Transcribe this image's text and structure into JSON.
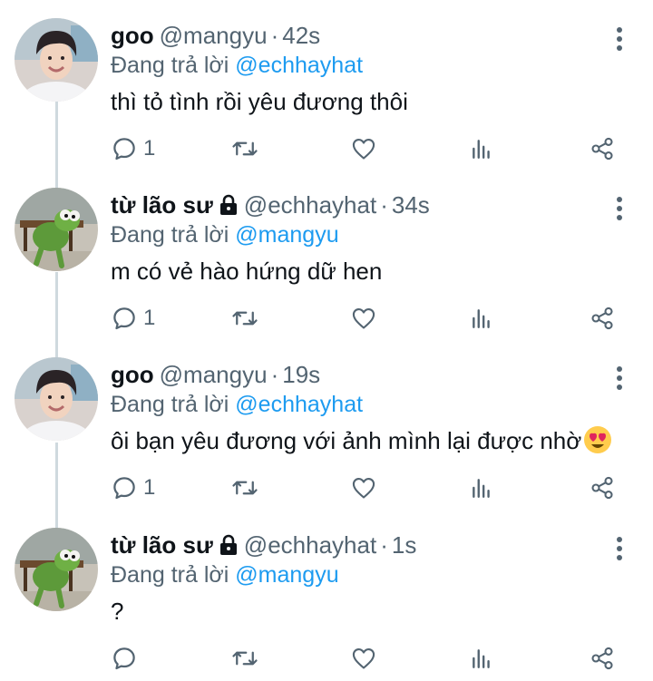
{
  "thread": {
    "tweets": [
      {
        "name": "goo",
        "handle": "@mangyu",
        "separator": "·",
        "time": "42s",
        "locked": false,
        "avatar_icon": "profile-photo-boy",
        "reply_prefix": "Đang trả lời",
        "reply_to": "@echhayhat",
        "text": "thì tỏ tình rồi yêu đương thôi",
        "emoji": "",
        "reply_count": "1"
      },
      {
        "name": "từ lão sư",
        "handle": "@echhayhat",
        "separator": "·",
        "time": "34s",
        "locked": true,
        "avatar_icon": "profile-photo-kermit",
        "reply_prefix": "Đang trả lời",
        "reply_to": "@mangyu",
        "text": "m có vẻ hào hứng dữ hen",
        "emoji": "",
        "reply_count": "1"
      },
      {
        "name": "goo",
        "handle": "@mangyu",
        "separator": "·",
        "time": "19s",
        "locked": false,
        "avatar_icon": "profile-photo-boy",
        "reply_prefix": "Đang trả lời",
        "reply_to": "@echhayhat",
        "text": "ôi bạn yêu đương với ảnh mình lại được nhờ",
        "emoji": "heart-eyes-emoji",
        "reply_count": "1"
      },
      {
        "name": "từ lão sư",
        "handle": "@echhayhat",
        "separator": "·",
        "time": "1s",
        "locked": true,
        "avatar_icon": "profile-photo-kermit",
        "reply_prefix": "Đang trả lời",
        "reply_to": "@mangyu",
        "text": "?",
        "emoji": "",
        "reply_count": ""
      }
    ]
  },
  "colors": {
    "text": "#0f1419",
    "secondary": "#536471",
    "mention": "#1d9bf0",
    "thread_line": "#cfd9de"
  },
  "icons": {
    "reply": "reply-icon",
    "retweet": "retweet-icon",
    "like": "heart-icon",
    "analytics": "analytics-icon",
    "share": "share-icon",
    "more": "more-vertical-icon",
    "protected": "lock-icon"
  }
}
